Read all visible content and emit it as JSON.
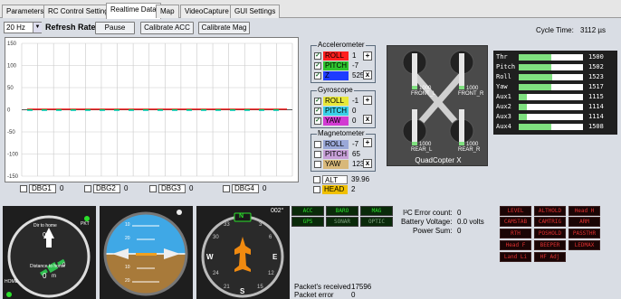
{
  "tabs": [
    "Parameters",
    "RC Control Settings",
    "Realtime Data",
    "Map",
    "VideoCapture",
    "GUI Settings"
  ],
  "toolbar": {
    "rate_value": "20 Hz",
    "refresh_rate_label": "Refresh Rate",
    "pause_label": "Pause",
    "calibrate_acc_label": "Calibrate ACC",
    "calibrate_mag_label": "Calibrate Mag"
  },
  "cycle_time": {
    "label": "Cycle Time:",
    "value": "3112 µs"
  },
  "chart_data": {
    "type": "line",
    "y_ticks": [
      "150",
      "100",
      "50",
      "0",
      "-50",
      "-100",
      "-150"
    ],
    "ylim": [
      -150,
      150
    ],
    "grid": true,
    "series": [
      {
        "color": "#ff0000",
        "values": [
          0,
          0,
          0,
          0,
          0
        ]
      },
      {
        "color": "#00c000",
        "values": [
          0,
          0,
          0,
          0,
          0
        ]
      },
      {
        "color": "#00c0c0",
        "values": [
          0,
          0,
          0,
          0,
          0
        ]
      }
    ]
  },
  "accelerometer": {
    "title": "Accelerometer",
    "rows": [
      {
        "name": "ROLL",
        "value": "1",
        "color": "#ff1e1e"
      },
      {
        "name": "PITCH",
        "value": "-7",
        "color": "#2ec42e"
      },
      {
        "name": "Z",
        "value": "525",
        "color": "#1e3cff"
      }
    ]
  },
  "gyroscope": {
    "title": "Gyroscope",
    "rows": [
      {
        "name": "ROLL",
        "value": "-1",
        "color": "#e8e83a"
      },
      {
        "name": "PITCH",
        "value": "0",
        "color": "#3ad0e8"
      },
      {
        "name": "YAW",
        "value": "0",
        "color": "#d23ad2"
      }
    ]
  },
  "magnetometer": {
    "title": "Magnetometer",
    "rows": [
      {
        "name": "ROLL",
        "value": "-7",
        "color": "#9aa8d8"
      },
      {
        "name": "PITCH",
        "value": "65",
        "color": "#c8a0d8"
      },
      {
        "name": "YAW",
        "value": "123",
        "color": "#d8b87a"
      }
    ]
  },
  "alt": {
    "name": "ALT",
    "value": "39.96"
  },
  "head": {
    "name": "HEAD",
    "value": "2"
  },
  "debug": [
    {
      "name": "DBG1",
      "value": "0"
    },
    {
      "name": "DBG2",
      "value": "0"
    },
    {
      "name": "DBG3",
      "value": "0"
    },
    {
      "name": "DBG4",
      "value": "0"
    }
  ],
  "quad": {
    "label": "QuadCopter X",
    "motors": [
      {
        "value": "1000",
        "name": "FRONT_L"
      },
      {
        "value": "1000",
        "name": "FRONT_R"
      },
      {
        "value": "1000",
        "name": "REAR_L"
      },
      {
        "value": "1000",
        "name": "REAR_R"
      }
    ]
  },
  "rc_channels": [
    {
      "name": "Thr",
      "value": "1500",
      "fill": 0.5
    },
    {
      "name": "Pitch",
      "value": "1502",
      "fill": 0.5
    },
    {
      "name": "Roll",
      "value": "1523",
      "fill": 0.52
    },
    {
      "name": "Yaw",
      "value": "1517",
      "fill": 0.51
    },
    {
      "name": "Aux1",
      "value": "1115",
      "fill": 0.12
    },
    {
      "name": "Aux2",
      "value": "1114",
      "fill": 0.12
    },
    {
      "name": "Aux3",
      "value": "1114",
      "fill": 0.12
    },
    {
      "name": "Aux4",
      "value": "1508",
      "fill": 0.51
    }
  ],
  "sensors": [
    {
      "name": "ACC",
      "on": true
    },
    {
      "name": "BARO",
      "on": true
    },
    {
      "name": "MAG",
      "on": true
    },
    {
      "name": "GPS",
      "on": true
    },
    {
      "name": "SONAR",
      "on": false
    },
    {
      "name": "OPTIC",
      "on": false
    }
  ],
  "status": {
    "i2c_label": "I²C Error count:",
    "i2c_value": "0",
    "battery_label": "Battery Voltage:",
    "battery_value": "0.0 volts",
    "power_label": "Power Sum:",
    "power_value": "0",
    "packets_received_label": "Packet's received",
    "packets_received_value": "17596",
    "packet_error_label": "Packet error",
    "packet_error_value": "0"
  },
  "modes": [
    "LEVEL",
    "ALTHOLD",
    "Head H",
    "CAMSTAB",
    "CAMTRIG",
    "ARM",
    "RTH",
    "POSHOLD",
    "PASSTHR",
    "Head F",
    "BEEPER",
    "LEDMAX",
    "Land Li",
    "HF Adj"
  ],
  "gps_gauge": {
    "pkt_label": "PKT",
    "dir_to_home_label": "Dir to home",
    "dir_to_home_value": "0°",
    "distance_label": "Distance to home",
    "distance_value": "0",
    "distance_unit": "m",
    "home_label": "HOME",
    "sat_count": "0"
  },
  "horizon": {
    "ticks": [
      "10",
      "20",
      "10",
      "20"
    ]
  },
  "compass": {
    "heading_value": "002°",
    "letters": [
      "N",
      "E",
      "S",
      "W"
    ],
    "numbers": [
      "3",
      "6",
      "12",
      "15",
      "21",
      "24",
      "30",
      "33"
    ]
  }
}
